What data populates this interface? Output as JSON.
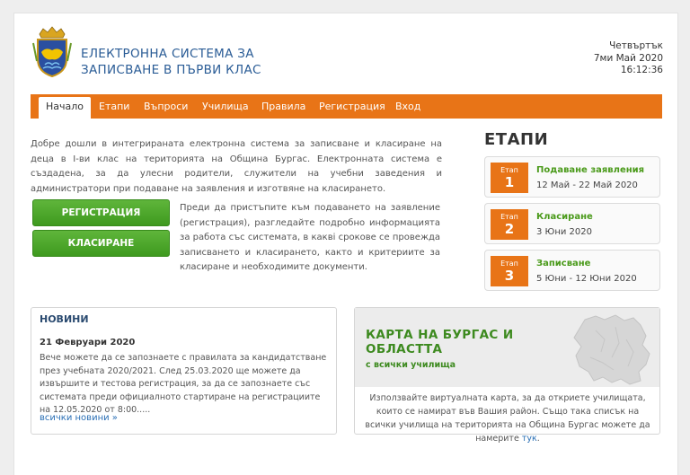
{
  "header": {
    "title_line1": "ЕЛЕКТРОННА СИСТЕМА ЗА",
    "title_line2": "ЗАПИСВАНЕ В ПЪРВИ КЛАС",
    "day": "Четвъртък",
    "date": "7ми Май 2020",
    "time": "16:12:36"
  },
  "nav": {
    "items": [
      "Начало",
      "Етапи",
      "Въпроси",
      "Училища",
      "Правила",
      "Регистрация",
      "Вход"
    ]
  },
  "intro": {
    "text": "Добре дошли в интегрираната електронна система за записване и класиране на деца в I-ви клас на територията на Община Бургас. Електронната система е създадена, за да улесни родители, служители на учебни заведения и администратори при подаване на заявления и изготвяне на класирането.",
    "prep_text": "Преди да пристъпите към подаването на заявление (регистрация), разгледайте подробно информацията за работа със системата, в каквi срокове се провежда записването и класирането, както и критериите за класиране и необходимите документи."
  },
  "buttons": {
    "register": "РЕГИСТРАЦИЯ",
    "ranking": "КЛАСИРАНЕ"
  },
  "stages": {
    "title": "ЕТАПИ",
    "badge_label": "Етап",
    "items": [
      {
        "num": "1",
        "name": "Подаване заявления",
        "date": "12 Май - 22 Май 2020"
      },
      {
        "num": "2",
        "name": "Класиране",
        "date": "3 Юни 2020"
      },
      {
        "num": "3",
        "name": "Записване",
        "date": "5 Юни - 12 Юни 2020"
      }
    ]
  },
  "news": {
    "title": "НОВИНИ",
    "date": "21 Февруари 2020",
    "text": "Вече можете да се запознаете с правилата за кандидатстване през учебната 2020/2021. След 25.03.2020 ще можете да извършите и тестова регистрация, за да се запознаете със системата преди официалното стартиране на регистрациите на 12.05.2020 от 8:00.....",
    "more": "всички новини »"
  },
  "map": {
    "title_line1": "КАРТА НА БУРГАС И",
    "title_line2": "ОБЛАСТТА",
    "subtitle": "с всички училища",
    "text": "Използвайте виртуалната карта, за да откриете училищата, които се намират във Вашия район. Също така списък на всички училища на територията на Община Бургас можете да намерите",
    "link": "тук",
    "period": "."
  },
  "colors": {
    "accent": "#e87417",
    "green": "#4a9a1a",
    "title_blue": "#2a5c96"
  }
}
